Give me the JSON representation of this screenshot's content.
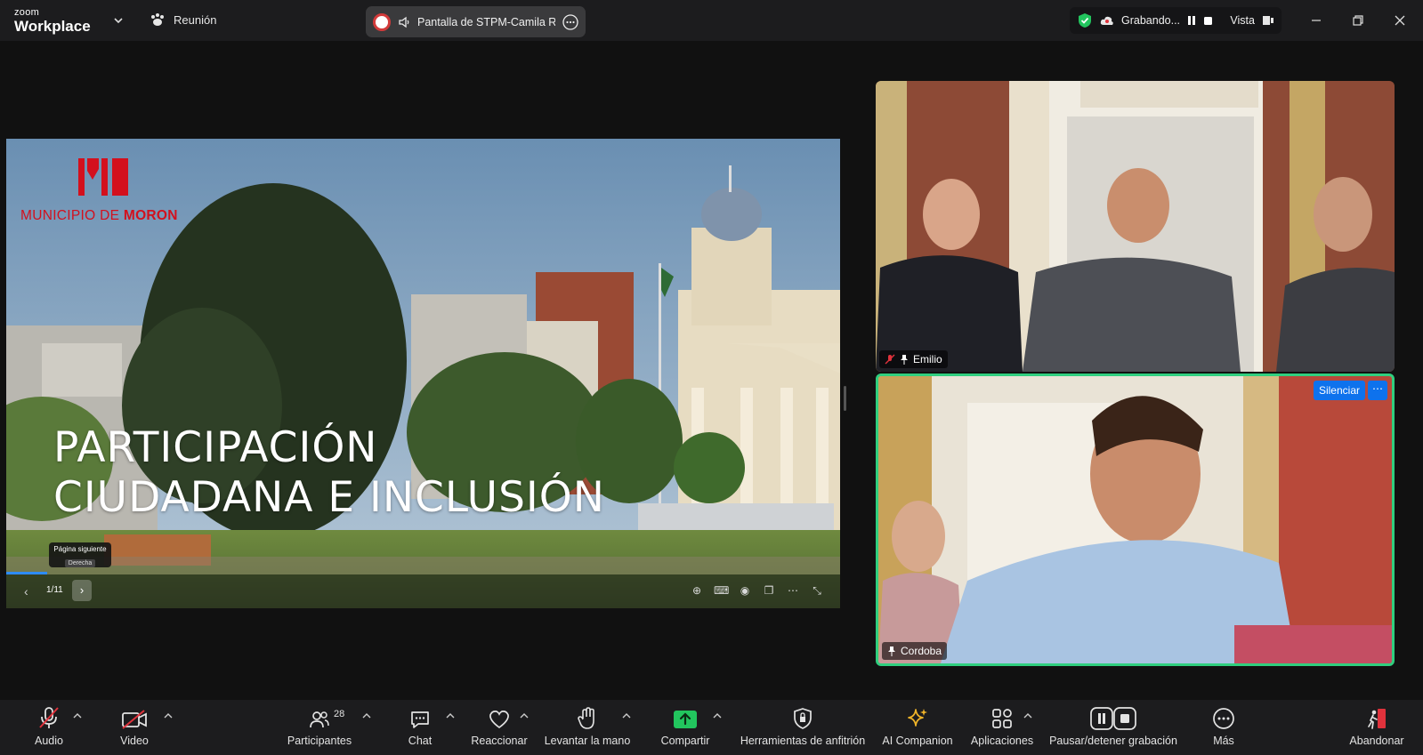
{
  "titlebar": {
    "brand_small": "zoom",
    "brand_big": "Workplace",
    "meeting_label": "Reunión",
    "share_label": "Pantalla de STPM-Camila Rc",
    "recording_label": "Grabando...",
    "view_label": "Vista"
  },
  "slide": {
    "logo_text_light": "MUNICIPIO DE ",
    "logo_text_bold": "MORON",
    "title_line1": "PARTICIPACIÓN",
    "title_line2": "CIUDADANA E INCLUSIÓN",
    "page_indicator": "1/11",
    "tooltip_title": "Página siguiente",
    "tooltip_key": "Derecha"
  },
  "tiles": {
    "emilio_name": "Emilio",
    "cordoba_name": "Cordoba",
    "mute_button": "Silenciar"
  },
  "toolbar": {
    "audio": "Audio",
    "video": "Video",
    "participants": "Participantes",
    "participants_count": "28",
    "chat": "Chat",
    "react": "Reaccionar",
    "raise_hand": "Levantar la mano",
    "share": "Compartir",
    "host_tools": "Herramientas de anfitrión",
    "ai_companion": "AI Companion",
    "apps": "Aplicaciones",
    "pause_recording": "Pausar/detener grabación",
    "more": "Más",
    "leave": "Abandonar"
  },
  "colors": {
    "accent_blue": "#0e72ed",
    "active_speaker_green": "#2fcf7f",
    "moron_red": "#d3101d",
    "share_green": "#22c55e",
    "leave_red": "#e0323c"
  }
}
